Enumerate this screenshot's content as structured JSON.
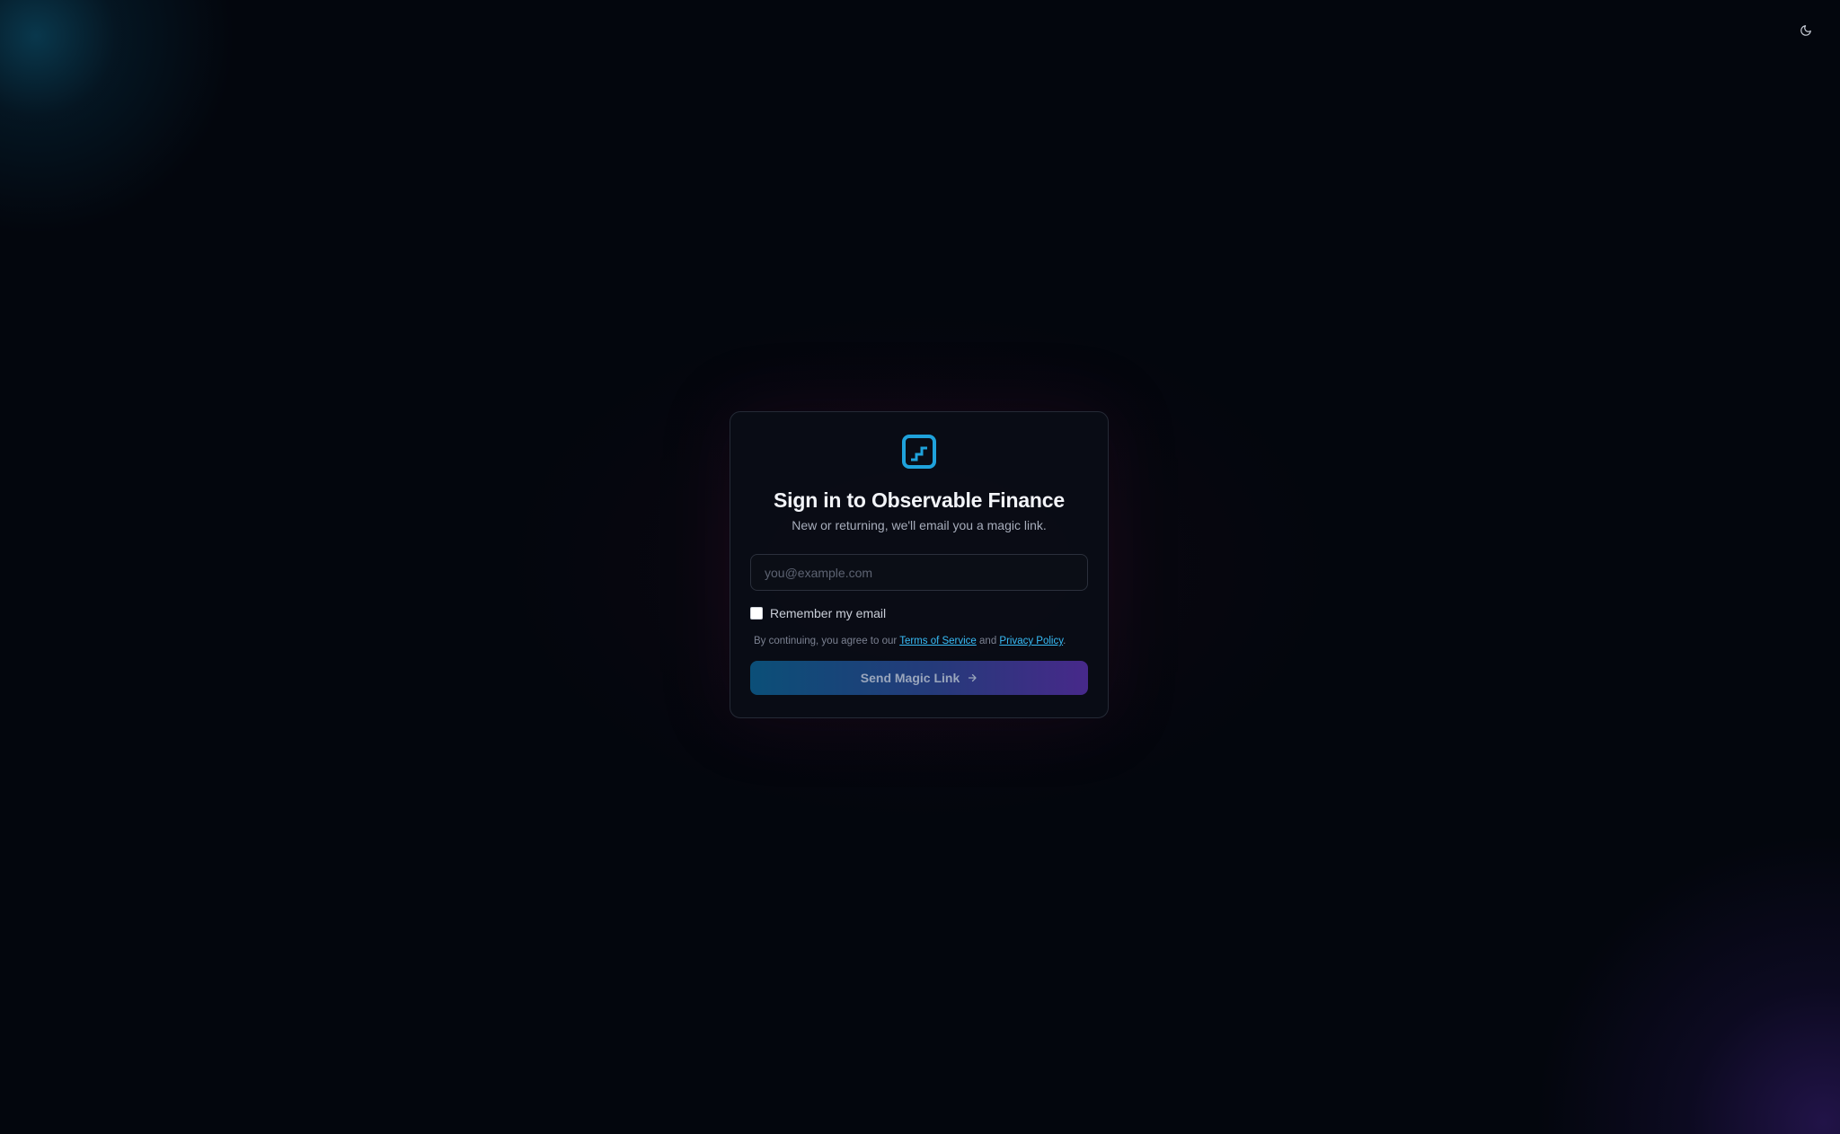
{
  "header": {
    "theme_toggle_icon": "moon-icon"
  },
  "login": {
    "logo_icon": "stairs-chart-icon",
    "title": "Sign in to Observable Finance",
    "subtitle": "New or returning, we'll email you a magic link.",
    "email_placeholder": "you@example.com",
    "email_value": "",
    "remember_label": "Remember my email",
    "remember_checked": false,
    "legal_prefix": "By continuing, you agree to our ",
    "terms_link": "Terms of Service",
    "legal_and": " and ",
    "privacy_link": "Privacy Policy",
    "legal_suffix": ".",
    "submit_label": "Send Magic Link",
    "submit_icon": "arrow-right-icon"
  },
  "colors": {
    "background": "#03060d",
    "accent": "#38bdf8",
    "logo": "#1fa2db",
    "button_gradient_start": "#0b4f78",
    "button_gradient_end": "#47298a"
  }
}
